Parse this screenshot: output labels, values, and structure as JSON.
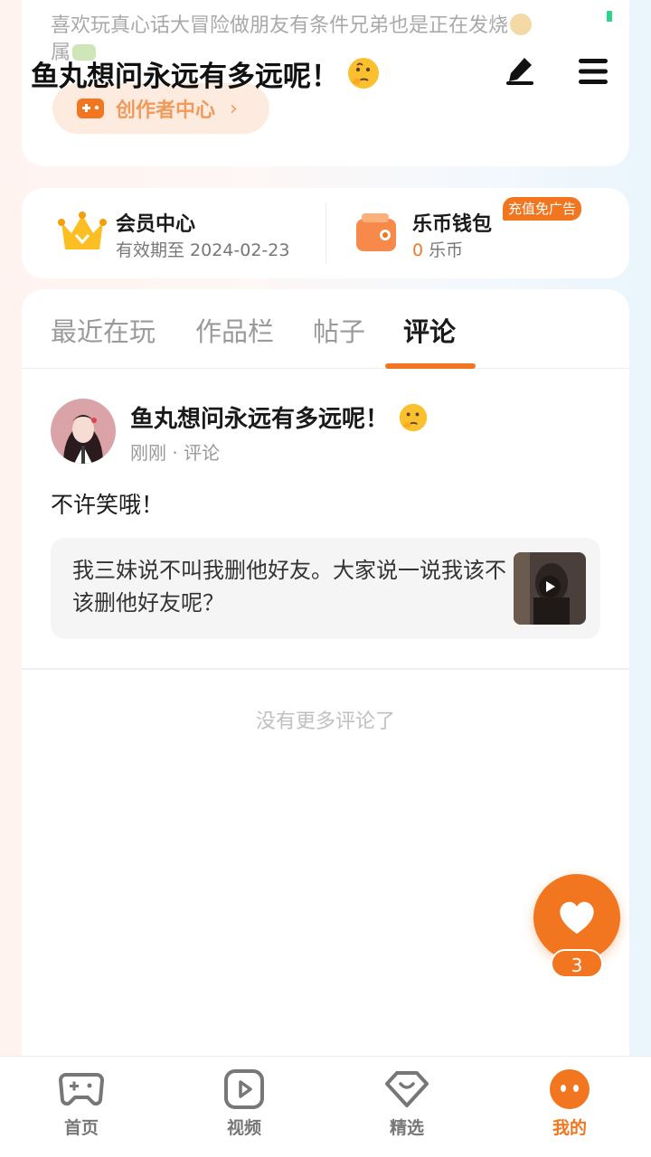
{
  "profile": {
    "bio": "喜欢玩真心话大冒险做朋友有条件兄弟也是正在发烧",
    "bio_line2": "属",
    "creator_center_label": "创作者中心"
  },
  "header": {
    "title": "鱼丸想问永远有多远呢！"
  },
  "membership": {
    "title": "会员中心",
    "expiry": "有效期至 2024-02-23"
  },
  "wallet": {
    "title": "乐币钱包",
    "amount": "0",
    "unit": "乐币",
    "badge": "充值免广告"
  },
  "tabs": [
    {
      "label": "最近在玩"
    },
    {
      "label": "作品栏"
    },
    {
      "label": "帖子"
    },
    {
      "label": "评论"
    }
  ],
  "comment": {
    "author": "鱼丸想问永远有多远呢！",
    "meta": "刚刚 · 评论",
    "text": "不许笑哦！",
    "quoted_post": "我三妹说不叫我删他好友。大家说一说我该不该删他好友呢？"
  },
  "no_more": "没有更多评论了",
  "like": {
    "count": "3"
  },
  "bottom_nav": [
    {
      "label": "首页"
    },
    {
      "label": "视频"
    },
    {
      "label": "精选"
    },
    {
      "label": "我的"
    }
  ],
  "colors": {
    "accent": "#f2761f",
    "creator_btn_bg": "#fdebe0",
    "status_dot": "#2bd48a"
  }
}
